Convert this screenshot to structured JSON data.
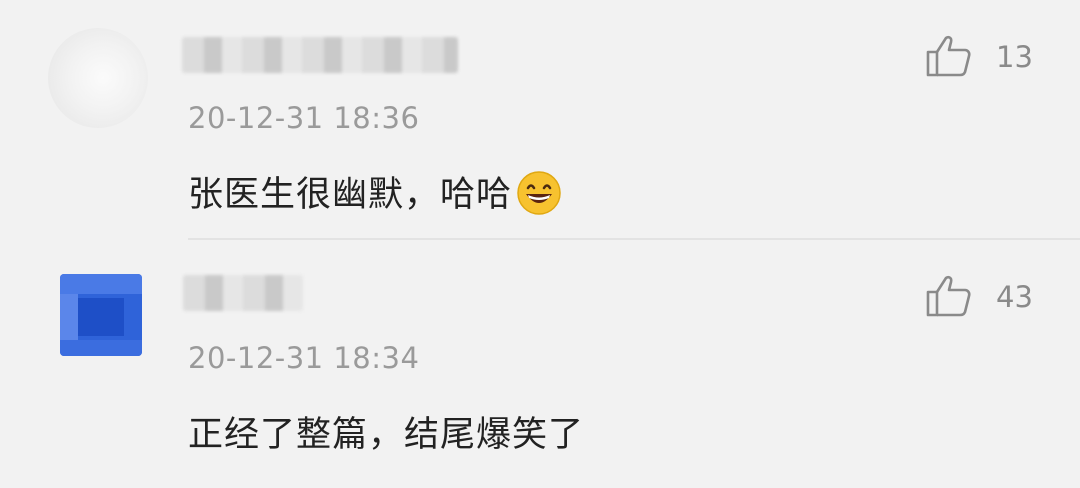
{
  "comments": [
    {
      "avatar_icon": "blurred-avatar",
      "time": "20-12-31 18:36",
      "text": "张医生很幽默，哈哈",
      "emoji": "grinning-face-icon",
      "likes": "13"
    },
    {
      "avatar_icon": "blurred-avatar",
      "time": "20-12-31 18:34",
      "text": "正经了整篇，结尾爆笑了",
      "likes": "43"
    }
  ],
  "colors": {
    "background": "#f2f2f2",
    "text": "#222222",
    "meta": "#9a9a9a"
  }
}
